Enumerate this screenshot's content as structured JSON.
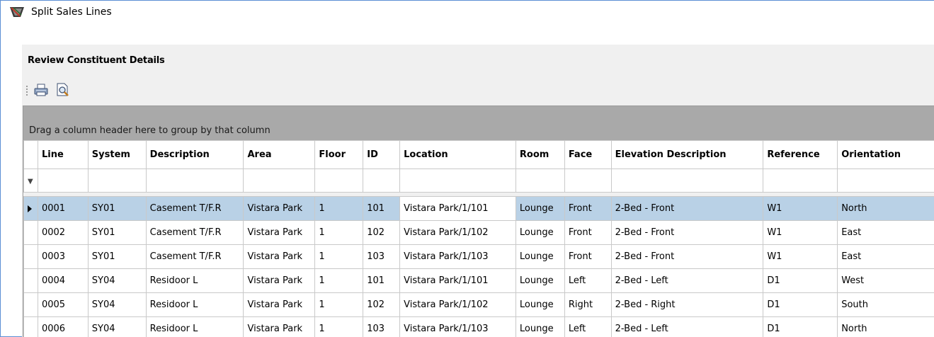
{
  "window": {
    "title": "Split Sales Lines"
  },
  "section": {
    "title": "Review Constituent Details"
  },
  "toolbar": {
    "print_icon": "printer-icon",
    "preview_icon": "print-preview-icon"
  },
  "grid": {
    "group_hint": "Drag a column header here to group by that column",
    "columns": [
      "Line",
      "System",
      "Description",
      "Area",
      "Floor",
      "ID",
      "Location",
      "Room",
      "Face",
      "Elevation Description",
      "Reference",
      "Orientation"
    ],
    "rows": [
      [
        "0001",
        "SY01",
        "Casement T/F.R",
        "Vistara Park",
        "1",
        "101",
        "Vistara Park/1/101",
        "Lounge",
        "Front",
        "2-Bed - Front",
        "W1",
        "North"
      ],
      [
        "0002",
        "SY01",
        "Casement T/F.R",
        "Vistara Park",
        "1",
        "102",
        "Vistara Park/1/102",
        "Lounge",
        "Front",
        "2-Bed - Front",
        "W1",
        "East"
      ],
      [
        "0003",
        "SY01",
        "Casement T/F.R",
        "Vistara Park",
        "1",
        "103",
        "Vistara Park/1/103",
        "Lounge",
        "Front",
        "2-Bed - Front",
        "W1",
        "East"
      ],
      [
        "0004",
        "SY04",
        "Residoor L",
        "Vistara Park",
        "1",
        "101",
        "Vistara Park/1/101",
        "Lounge",
        "Left",
        "2-Bed - Left",
        "D1",
        "West"
      ],
      [
        "0005",
        "SY04",
        "Residoor L",
        "Vistara Park",
        "1",
        "102",
        "Vistara Park/1/102",
        "Lounge",
        "Right",
        "2-Bed - Right",
        "D1",
        "South"
      ],
      [
        "0006",
        "SY04",
        "Residoor L",
        "Vistara Park",
        "1",
        "103",
        "Vistara Park/1/103",
        "Lounge",
        "Left",
        "2-Bed - Left",
        "D1",
        "North"
      ]
    ],
    "selected_row": 0
  },
  "colors": {
    "selected_row": "#b9d1e6",
    "group_panel": "#a9a9a9",
    "window_border": "#5b8fd4"
  }
}
